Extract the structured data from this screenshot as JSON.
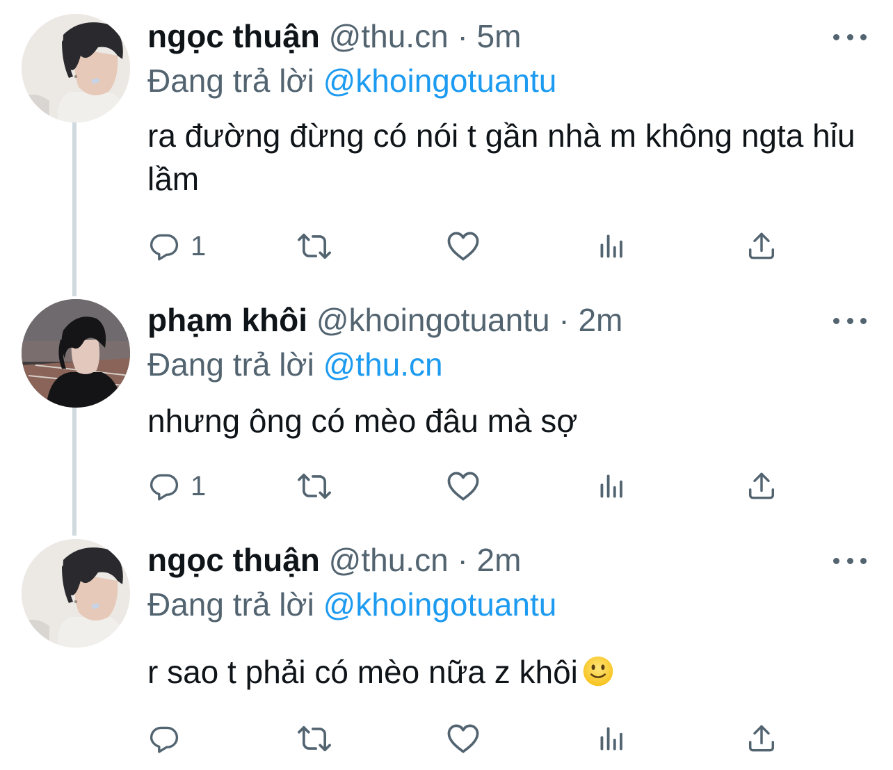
{
  "tweets": [
    {
      "name": "ngọc thuận",
      "handle": "@thu.cn",
      "separator": "·",
      "time": "5m",
      "reply_prefix": "Đang trả lời",
      "reply_to": "@khoingotuantu",
      "text": "ra đường đừng có nói t gần nhà m không ngta hỉu lầm",
      "reply_count": "1",
      "retweet_count": "",
      "like_count": ""
    },
    {
      "name": "phạm khôi",
      "handle": "@khoingotuantu",
      "separator": "·",
      "time": "2m",
      "reply_prefix": "Đang trả lời",
      "reply_to": "@thu.cn",
      "text": "nhưng ông có mèo đâu mà sợ",
      "reply_count": "1",
      "retweet_count": "",
      "like_count": ""
    },
    {
      "name": "ngọc thuận",
      "handle": "@thu.cn",
      "separator": "·",
      "time": "2m",
      "reply_prefix": "Đang trả lời",
      "reply_to": "@khoingotuantu",
      "text": "r sao t phải có mèo nữa z khôi",
      "emoji": "slightly-smiling-face-emoji",
      "reply_count": "",
      "retweet_count": "",
      "like_count": ""
    }
  ],
  "icons": {
    "reply": "reply-icon",
    "retweet": "retweet-icon",
    "like": "heart-icon",
    "analytics": "analytics-icon",
    "share": "share-icon",
    "more": "more-icon"
  },
  "colors": {
    "text": "#0f1419",
    "secondary": "#536471",
    "mention": "#1d9bf0",
    "thread_line": "#cfd9de",
    "background": "#ffffff"
  }
}
